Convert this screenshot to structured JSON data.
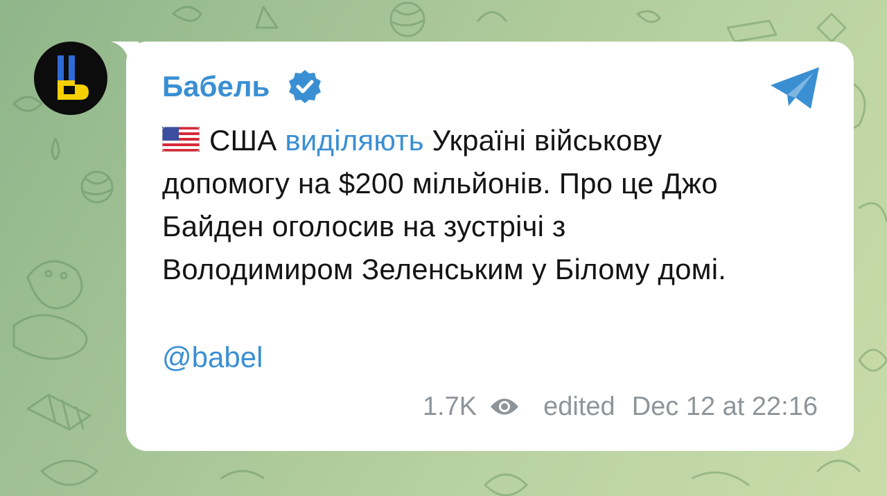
{
  "channel": {
    "name": "Бабель",
    "verified": true,
    "avatar_letter": "Ь",
    "avatar_colors": [
      "#0c0c0c",
      "#2f6bd8",
      "#f6d000"
    ]
  },
  "message": {
    "flag": "us-flag",
    "lines": [
      {
        "before": "США ",
        "link": "виділяють",
        "after": " Україні військову"
      },
      {
        "text": "допомогу на $200 мільйонів. Про це Джо"
      },
      {
        "text": "Байден оголосив на зустрічі з"
      },
      {
        "text": "Володимиром Зеленським у Білому домі."
      }
    ],
    "mention": "@babel"
  },
  "meta": {
    "views": "1.7K",
    "views_icon": "eye-icon",
    "edited_label": "edited",
    "timestamp": "Dec 12 at 22:16"
  },
  "icons": {
    "share": "telegram-share-icon",
    "verified": "verified-badge-icon"
  },
  "colors": {
    "accent": "#3a8fd3",
    "text": "#141414",
    "meta": "#8e9499",
    "bubble": "#ffffff"
  }
}
